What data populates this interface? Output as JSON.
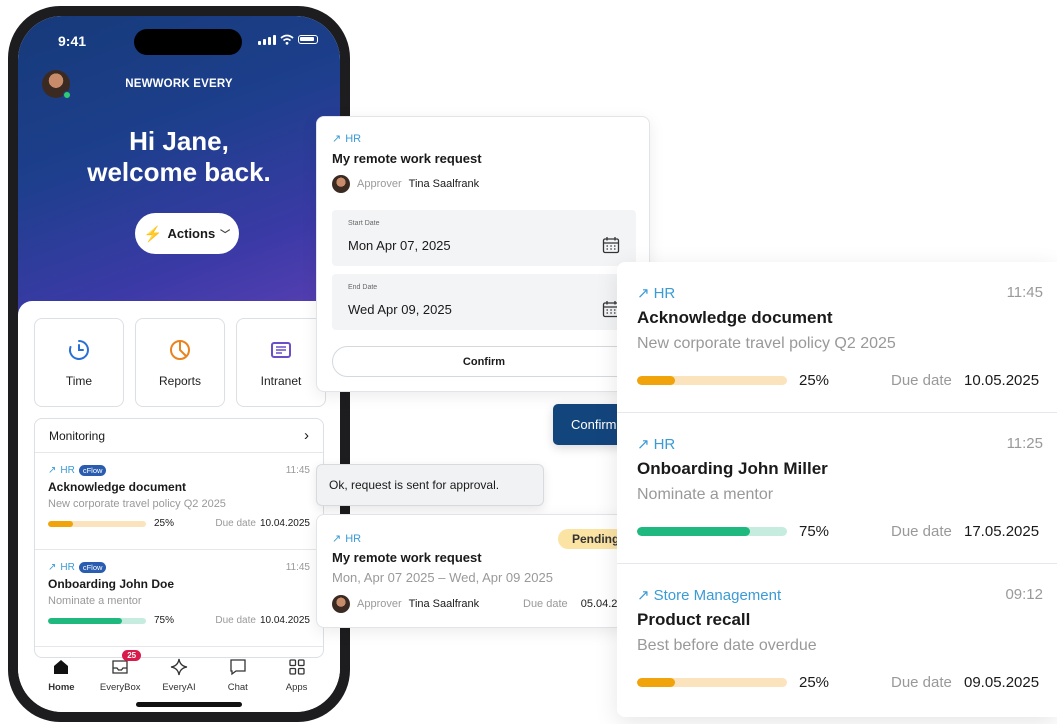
{
  "status": {
    "time": "9:41"
  },
  "app": {
    "brand": "NEWWORK EVERY",
    "greeting_line1": "Hi Jane,",
    "greeting_line2": "welcome back.",
    "actions_label": "Actions"
  },
  "tiles": [
    {
      "label": "Time",
      "icon": "clock-icon"
    },
    {
      "label": "Reports",
      "icon": "pie-chart-icon"
    },
    {
      "label": "Intranet",
      "icon": "newspaper-icon"
    }
  ],
  "monitoring": {
    "title": "Monitoring",
    "items": [
      {
        "tag": "HR",
        "badge": "cFlow",
        "time": "11:45",
        "title": "Acknowledge document",
        "subtitle": "New corporate travel policy Q2 2025",
        "progress": 0.25,
        "percent": "25%",
        "due_label": "Due date",
        "due": "10.04.2025",
        "color": "#f0a30a"
      },
      {
        "tag": "HR",
        "badge": "cFlow",
        "time": "11:45",
        "title": "Onboarding John Doe",
        "subtitle": "Nominate a mentor",
        "progress": 0.75,
        "percent": "75%",
        "due_label": "Due date",
        "due": "10.04.2025",
        "color": "#1fb87f"
      }
    ]
  },
  "tabbar": [
    {
      "label": "Home",
      "icon": "home-icon"
    },
    {
      "label": "EveryBox",
      "icon": "inbox-icon",
      "badge": "25"
    },
    {
      "label": "EveryAI",
      "icon": "sparkle-icon"
    },
    {
      "label": "Chat",
      "icon": "chat-icon"
    },
    {
      "label": "Apps",
      "icon": "apps-grid-icon"
    }
  ],
  "request": {
    "tag": "HR",
    "title": "My remote work request",
    "approver_label": "Approver",
    "approver": "Tina Saalfrank",
    "start_label": "Start Date",
    "start_value": "Mon Apr 07, 2025",
    "end_label": "End Date",
    "end_value": "Wed Apr 09, 2025",
    "confirm_label": "Confirm"
  },
  "confirm_button": "Confirm",
  "toast": "Ok, request is sent for approval.",
  "pending": {
    "tag": "HR",
    "status": "Pending",
    "title": "My remote work request",
    "dates": "Mon, Apr 07 2025 – Wed, Apr 09 2025",
    "approver_label": "Approver",
    "approver": "Tina Saalfrank",
    "due_label": "Due date",
    "due": "05.04.2"
  },
  "tasks": [
    {
      "tag": "HR",
      "time": "11:45",
      "title": "Acknowledge document",
      "subtitle": "New corporate travel policy Q2 2025",
      "progress": 0.25,
      "percent": "25%",
      "due_label": "Due date",
      "due": "10.05.2025",
      "color": "#f0a30a",
      "track": "#fbe3bd"
    },
    {
      "tag": "HR",
      "time": "11:25",
      "title": "Onboarding John Miller",
      "subtitle": "Nominate a mentor",
      "progress": 0.75,
      "percent": "75%",
      "due_label": "Due date",
      "due": "17.05.2025",
      "color": "#1fb87f",
      "track": "#c6ece0"
    },
    {
      "tag": "Store Management",
      "time": "09:12",
      "title": "Product recall",
      "subtitle": "Best before date overdue",
      "progress": 0.25,
      "percent": "25%",
      "due_label": "Due date",
      "due": "09.05.2025",
      "color": "#f0a30a",
      "track": "#fbe3bd"
    }
  ],
  "colors": {
    "accent_blue": "#13457d",
    "tag_blue": "#3a9bd5",
    "badge_red": "#d81b4a",
    "pending_yellow": "#fbe3a4"
  }
}
